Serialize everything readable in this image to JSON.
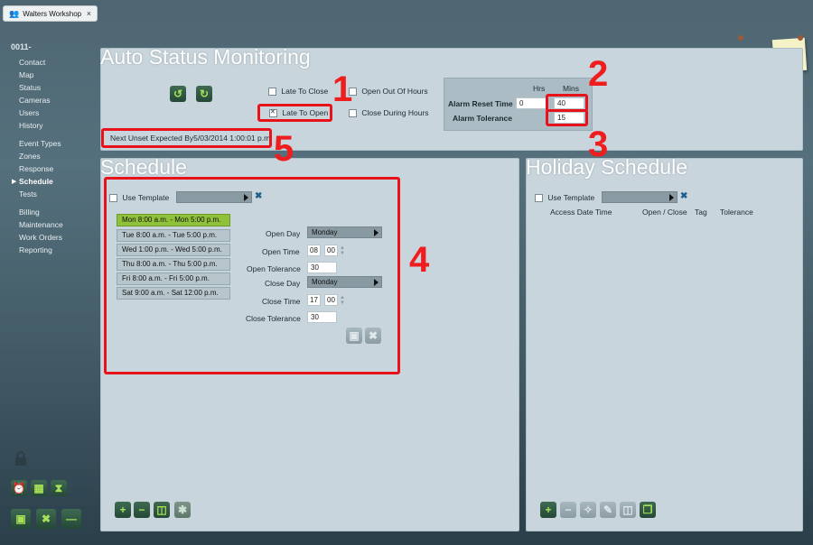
{
  "tab": {
    "title": "Walters Workshop",
    "close": "×"
  },
  "nav": {
    "site": "0011-",
    "items": [
      "Contact",
      "Map",
      "Status",
      "Cameras",
      "Users",
      "History",
      "Event Types",
      "Zones",
      "Response",
      "Schedule",
      "Tests",
      "Billing",
      "Maintenance",
      "Work Orders",
      "Reporting"
    ],
    "active": "Schedule"
  },
  "auto_status": {
    "title": "Auto Status Monitoring",
    "late_to_close": "Late To Close",
    "late_to_open": "Late To Open",
    "open_out_of_hours": "Open Out Of Hours",
    "close_during_hours": "Close During Hours",
    "hrs": "Hrs",
    "mins": "Mins",
    "alarm_reset_time": "Alarm Reset Time",
    "alarm_reset_hrs": "0",
    "alarm_reset_mins": "40",
    "alarm_tolerance": "Alarm Tolerance",
    "alarm_tolerance_mins": "15",
    "next_unset": "Next Unset Expected By5/03/2014 1:00:01 p.m."
  },
  "schedule": {
    "title": "Schedule",
    "use_template": "Use Template",
    "rows": [
      "Mon 8:00 a.m. - Mon 5:00 p.m.",
      "Tue 8:00 a.m. - Tue 5:00 p.m.",
      "Wed 1:00 p.m. - Wed 5:00 p.m.",
      "Thu 8:00 a.m. - Thu 5:00 p.m.",
      "Fri 8:00 a.m. - Fri 5:00 p.m.",
      "Sat 9:00 a.m. - Sat 12:00 p.m."
    ],
    "open_day_label": "Open Day",
    "open_day": "Monday",
    "open_time_label": "Open Time",
    "open_hour": "08",
    "open_min": "00",
    "open_tolerance_label": "Open Tolerance",
    "open_tolerance": "30",
    "close_day_label": "Close Day",
    "close_day": "Monday",
    "close_time_label": "Close Time",
    "close_hour": "17",
    "close_min": "00",
    "close_tolerance_label": "Close Tolerance",
    "close_tolerance": "30"
  },
  "holiday": {
    "title": "Holiday Schedule",
    "use_template": "Use Template",
    "columns": [
      "Access Date Time",
      "Open / Close",
      "Tag",
      "Tolerance"
    ]
  },
  "annotations": {
    "n1": "1",
    "n2": "2",
    "n3": "3",
    "n4": "4",
    "n5": "5"
  },
  "colors": {
    "highlight": "#e8121b",
    "active_row": "#8fc23a",
    "accent_icon": "#a9e05a"
  }
}
